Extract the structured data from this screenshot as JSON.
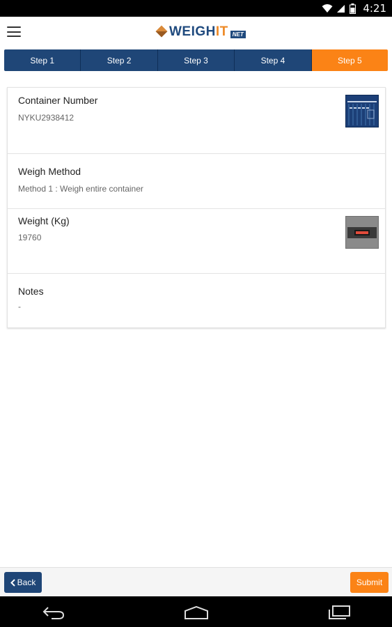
{
  "status_bar": {
    "time": "4:21"
  },
  "app": {
    "logo_main": "WEIGH",
    "logo_accent": "IT",
    "logo_suffix": "NET"
  },
  "steps": [
    {
      "label": "Step 1",
      "active": false
    },
    {
      "label": "Step 2",
      "active": false
    },
    {
      "label": "Step 3",
      "active": false
    },
    {
      "label": "Step 4",
      "active": false
    },
    {
      "label": "Step 5",
      "active": true
    }
  ],
  "summary": {
    "container": {
      "label": "Container Number",
      "value": "NYKU2938412"
    },
    "method": {
      "label": "Weigh Method",
      "value": "Method 1 : Weigh entire container"
    },
    "weight": {
      "label": "Weight (Kg)",
      "value": "19760"
    },
    "notes": {
      "label": "Notes",
      "value": "-"
    }
  },
  "footer": {
    "back_label": "Back",
    "submit_label": "Submit"
  },
  "colors": {
    "navy": "#1f4677",
    "orange": "#fb8316"
  }
}
